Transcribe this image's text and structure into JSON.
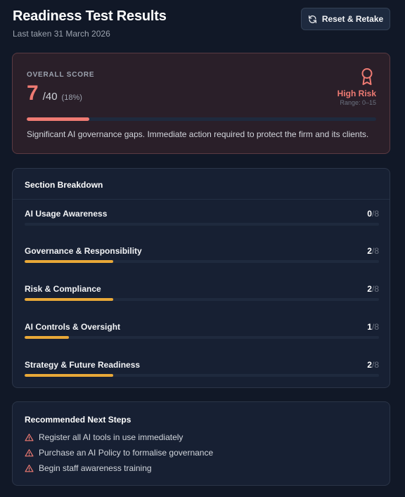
{
  "header": {
    "title": "Readiness Test Results",
    "subtitle": "Last taken 31 March 2026",
    "reset_label": "Reset & Retake",
    "reset_icon": "refresh-icon"
  },
  "score": {
    "label": "OVERALL SCORE",
    "value": "7",
    "max": "/40",
    "percent_text": "(18%)",
    "fraction": 0.18,
    "risk_label": "High Risk",
    "risk_range": "Range: 0–15",
    "icon": "award-icon",
    "message": "Significant AI governance gaps. Immediate action required to protect the firm and its clients.",
    "accent_color": "#ef7b73"
  },
  "breakdown": {
    "title": "Section Breakdown",
    "bar_color": "#e8a838",
    "sections": [
      {
        "name": "AI Usage Awareness",
        "score": "0",
        "max": "/8",
        "fraction": 0.0
      },
      {
        "name": "Governance & Responsibility",
        "score": "2",
        "max": "/8",
        "fraction": 0.25
      },
      {
        "name": "Risk & Compliance",
        "score": "2",
        "max": "/8",
        "fraction": 0.25
      },
      {
        "name": "AI Controls & Oversight",
        "score": "1",
        "max": "/8",
        "fraction": 0.125
      },
      {
        "name": "Strategy & Future Readiness",
        "score": "2",
        "max": "/8",
        "fraction": 0.25
      }
    ]
  },
  "next_steps": {
    "title": "Recommended Next Steps",
    "icon": "warning-triangle-icon",
    "items": [
      "Register all AI tools in use immediately",
      "Purchase an AI Policy to formalise governance",
      "Begin staff awareness training"
    ]
  }
}
